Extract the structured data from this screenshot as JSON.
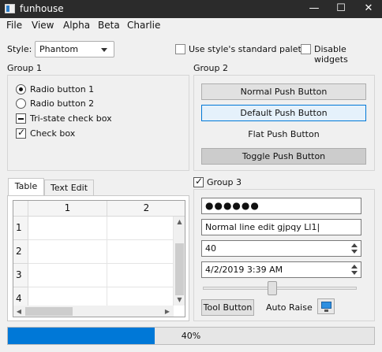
{
  "window": {
    "title": "funhouse",
    "minimize": "—",
    "maximize": "☐",
    "close": "✕"
  },
  "menu": [
    "File",
    "View",
    "Alpha",
    "Beta",
    "Charlie"
  ],
  "style_label": "Style:",
  "style_value": "Phantom",
  "use_palette_label": "Use style's standard palette",
  "disable_widgets_label": "Disable widgets",
  "group1": {
    "title": "Group 1",
    "radio1": "Radio button 1",
    "radio2": "Radio button 2",
    "tristate": "Tri-state check box",
    "check": "Check box"
  },
  "group2": {
    "title": "Group 2",
    "normal": "Normal Push Button",
    "default": "Default Push Button",
    "flat": "Flat Push Button",
    "toggle": "Toggle Push Button"
  },
  "tabs": [
    "Table",
    "Text Edit"
  ],
  "table": {
    "columns": [
      "1",
      "2"
    ],
    "rows": [
      "1",
      "2",
      "3",
      "4"
    ]
  },
  "group3": {
    "title": "Group 3",
    "password": "●●●●●●",
    "line_edit": "Normal line edit gjpqy Ll1|",
    "spin_value": "40",
    "datetime": "4/2/2019 3:39 AM",
    "slider_level": 0.45,
    "tool_button": "Tool Button",
    "auto_raise": "Auto Raise"
  },
  "progress": {
    "value": 40,
    "text": "40%"
  },
  "colors": {
    "accent": "#0078d7",
    "titlebar": "#2b2b2b"
  }
}
